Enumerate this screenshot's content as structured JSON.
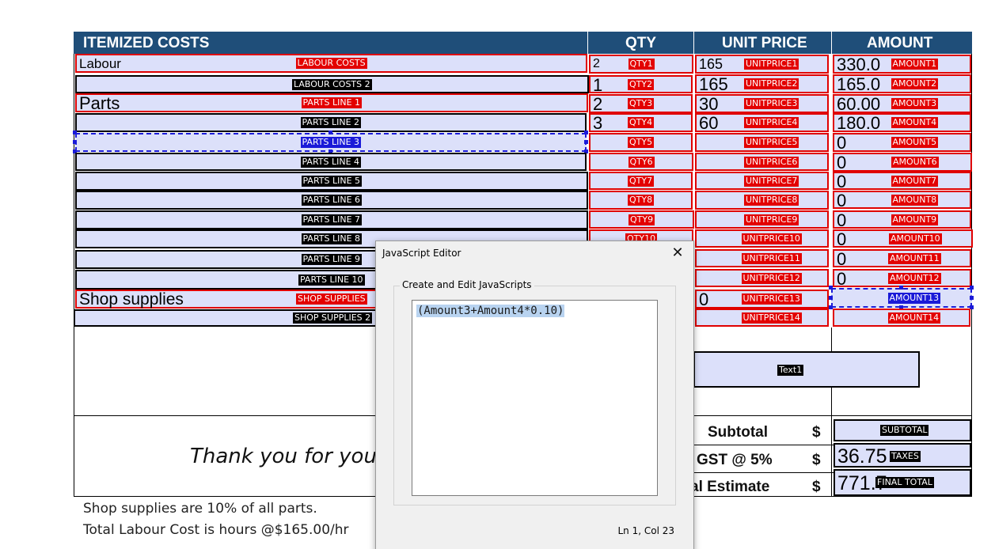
{
  "table": {
    "headers": [
      "ITEMIZED COSTS",
      "QTY",
      "UNIT PRICE",
      "AMOUNT"
    ],
    "desc_fields": [
      {
        "label": "LABOUR COSTS",
        "value": "Labour",
        "color": "red"
      },
      {
        "label": "LABOUR COSTS 2",
        "value": "",
        "color": "black"
      },
      {
        "label": "PARTS LINE 1",
        "value": "Parts",
        "color": "red"
      },
      {
        "label": "PARTS LINE 2",
        "value": "",
        "color": "black"
      },
      {
        "label": "PARTS LINE 3",
        "value": "",
        "color": "black",
        "selected": true
      },
      {
        "label": "PARTS LINE 4",
        "value": "",
        "color": "black"
      },
      {
        "label": "PARTS LINE 5",
        "value": "",
        "color": "black"
      },
      {
        "label": "PARTS LINE 6",
        "value": "",
        "color": "black"
      },
      {
        "label": "PARTS LINE 7",
        "value": "",
        "color": "black"
      },
      {
        "label": "PARTS LINE 8",
        "value": "",
        "color": "black"
      },
      {
        "label": "PARTS LINE 9",
        "value": "",
        "color": "black"
      },
      {
        "label": "PARTS LINE 10",
        "value": "",
        "color": "black"
      },
      {
        "label": "SHOP SUPPLIES",
        "value": "Shop supplies",
        "color": "red"
      },
      {
        "label": "SHOP SUPPLIES 2",
        "value": "",
        "color": "black"
      }
    ],
    "qty_fields": [
      {
        "label": "QTY1",
        "value": "2"
      },
      {
        "label": "QTY2",
        "value": "1"
      },
      {
        "label": "QTY3",
        "value": "2"
      },
      {
        "label": "QTY4",
        "value": "3"
      },
      {
        "label": "QTY5",
        "value": ""
      },
      {
        "label": "QTY6",
        "value": ""
      },
      {
        "label": "QTY7",
        "value": ""
      },
      {
        "label": "QTY8",
        "value": ""
      },
      {
        "label": "QTY9",
        "value": ""
      },
      {
        "label": "QTY10",
        "value": ""
      }
    ],
    "unit_price_fields": [
      {
        "label": "UNITPRICE1",
        "value": "165"
      },
      {
        "label": "UNITPRICE2",
        "value": "165"
      },
      {
        "label": "UNITPRICE3",
        "value": "30"
      },
      {
        "label": "UNITPRICE4",
        "value": "60"
      },
      {
        "label": "UNITPRICE5",
        "value": ""
      },
      {
        "label": "UNITPRICE6",
        "value": ""
      },
      {
        "label": "UNITPRICE7",
        "value": ""
      },
      {
        "label": "UNITPRICE8",
        "value": ""
      },
      {
        "label": "UNITPRICE9",
        "value": ""
      },
      {
        "label": "UNITPRICE10",
        "value": ""
      },
      {
        "label": "UNITPRICE11",
        "value": ""
      },
      {
        "label": "UNITPRICE12",
        "value": ""
      },
      {
        "label": "UNITPRICE13",
        "value": "0"
      },
      {
        "label": "UNITPRICE14",
        "value": ""
      }
    ],
    "amount_fields": [
      {
        "label": "AMOUNT1",
        "value": "330.0"
      },
      {
        "label": "AMOUNT2",
        "value": "165.0"
      },
      {
        "label": "AMOUNT3",
        "value": "60.00"
      },
      {
        "label": "AMOUNT4",
        "value": "180.0"
      },
      {
        "label": "AMOUNT5",
        "value": "0"
      },
      {
        "label": "AMOUNT6",
        "value": "0"
      },
      {
        "label": "AMOUNT7",
        "value": "0"
      },
      {
        "label": "AMOUNT8",
        "value": "0"
      },
      {
        "label": "AMOUNT9",
        "value": "0"
      },
      {
        "label": "AMOUNT10",
        "value": "0"
      },
      {
        "label": "AMOUNT11",
        "value": "0"
      },
      {
        "label": "AMOUNT12",
        "value": "0"
      },
      {
        "label": "AMOUNT13",
        "value": "",
        "selected": true
      },
      {
        "label": "AMOUNT14",
        "value": ""
      }
    ],
    "text1": {
      "label": "Text1"
    }
  },
  "summary": {
    "thanks": "Thank you for your",
    "subtotal_label": "Subtotal",
    "gst_label": "GST @ 5%",
    "total_label": "al Estimate",
    "currency": "$",
    "subtotal": {
      "label": "SUBTOTAL",
      "value": ""
    },
    "taxes": {
      "label": "TAXES",
      "value": "36.75"
    },
    "final_total": {
      "label": "FINAL TOTAL",
      "value": "771.7"
    }
  },
  "notes": [
    "Shop supplies are 10% of all parts.",
    "Total Labour Cost is hours @$165.00/hr"
  ],
  "dialog": {
    "title": "JavaScript Editor",
    "close_label": "✕",
    "group_label": "Create and Edit JavaScripts",
    "code": "(Amount3+Amount4*0.10)",
    "status": "Ln 1, Col 23"
  },
  "colors": {
    "header_bg": "#1f4e79",
    "field_bg": "#dce0fa",
    "field_border_red": "#e00000",
    "selection_blue": "#1a1ad8"
  }
}
